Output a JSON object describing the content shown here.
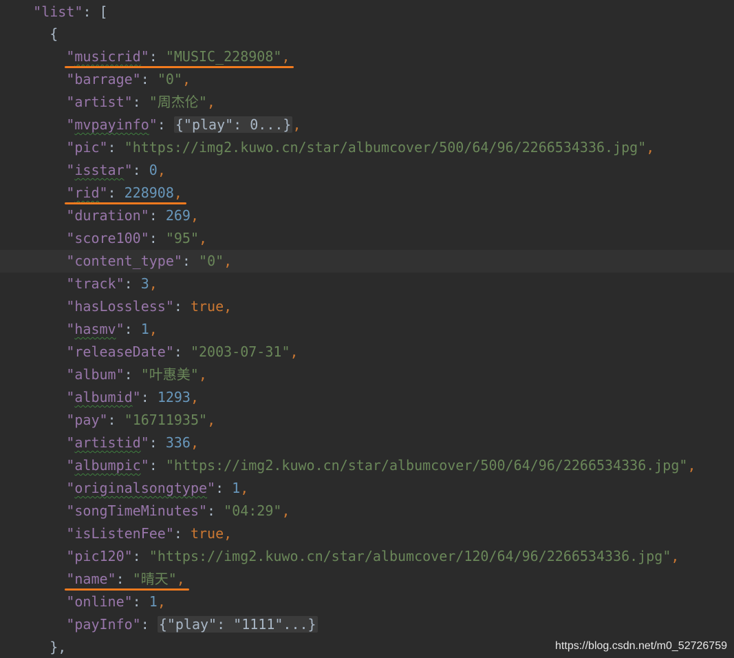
{
  "header": {
    "key": "list",
    "open": "["
  },
  "object_open": "{",
  "object_close": "},",
  "current_line": 9,
  "fields": [
    {
      "key": "musicrid",
      "type": "string",
      "value": "MUSIC_228908",
      "squiggle": true,
      "marked": true
    },
    {
      "key": "barrage",
      "type": "string",
      "value": "0"
    },
    {
      "key": "artist",
      "type": "string",
      "value": "周杰伦"
    },
    {
      "key": "mvpayinfo",
      "type": "fold",
      "value": "{\"play\": 0...}",
      "squiggle": true
    },
    {
      "key": "pic",
      "type": "string",
      "value": "https://img2.kuwo.cn/star/albumcover/500/64/96/2266534336.jpg"
    },
    {
      "key": "isstar",
      "type": "number",
      "value": "0",
      "squiggle": true
    },
    {
      "key": "rid",
      "type": "number",
      "value": "228908",
      "squiggle": true,
      "marked": true
    },
    {
      "key": "duration",
      "type": "number",
      "value": "269"
    },
    {
      "key": "score100",
      "type": "string",
      "value": "95"
    },
    {
      "key": "content_type",
      "type": "string",
      "value": "0"
    },
    {
      "key": "track",
      "type": "number",
      "value": "3"
    },
    {
      "key": "hasLossless",
      "type": "bool",
      "value": "true"
    },
    {
      "key": "hasmv",
      "type": "number",
      "value": "1",
      "squiggle": true
    },
    {
      "key": "releaseDate",
      "type": "string",
      "value": "2003-07-31"
    },
    {
      "key": "album",
      "type": "string",
      "value": "叶惠美"
    },
    {
      "key": "albumid",
      "type": "number",
      "value": "1293",
      "squiggle": true
    },
    {
      "key": "pay",
      "type": "string",
      "value": "16711935"
    },
    {
      "key": "artistid",
      "type": "number",
      "value": "336",
      "squiggle": true
    },
    {
      "key": "albumpic",
      "type": "string",
      "value": "https://img2.kuwo.cn/star/albumcover/500/64/96/2266534336.jpg",
      "squiggle": true
    },
    {
      "key": "originalsongtype",
      "type": "number",
      "value": "1",
      "squiggle": true
    },
    {
      "key": "songTimeMinutes",
      "type": "string",
      "value": "04:29"
    },
    {
      "key": "isListenFee",
      "type": "bool",
      "value": "true"
    },
    {
      "key": "pic120",
      "type": "string",
      "value": "https://img2.kuwo.cn/star/albumcover/120/64/96/2266534336.jpg"
    },
    {
      "key": "name",
      "type": "string",
      "value": "晴天",
      "marked": true
    },
    {
      "key": "online",
      "type": "number",
      "value": "1"
    },
    {
      "key": "payInfo",
      "type": "fold",
      "value": "{\"play\": \"1111\"...}",
      "last": true
    }
  ],
  "watermark": "https://blog.csdn.net/m0_52726759",
  "colors": {
    "background": "#2b2b2b",
    "current_line": "#323232",
    "key": "#9876aa",
    "string": "#6a8759",
    "number": "#6897bb",
    "keyword": "#cc7832",
    "text": "#a9b7c6",
    "annotation": "#f07a1e"
  }
}
